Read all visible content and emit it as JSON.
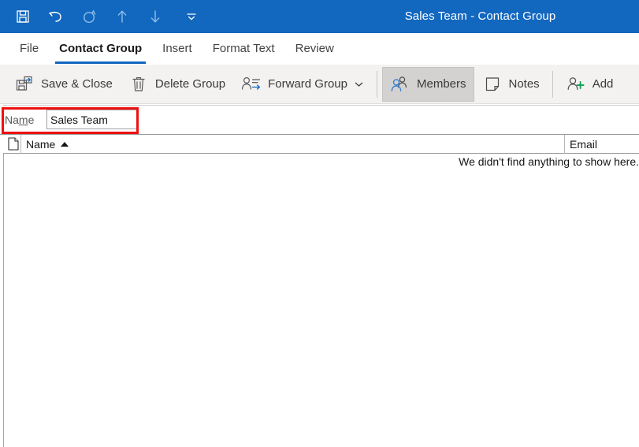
{
  "window": {
    "title": "Sales Team  -  Contact Group",
    "accent_color": "#1267bf",
    "ribbon_bg": "#f3f2f1"
  },
  "quick_access": {
    "items": [
      {
        "name": "save-icon",
        "label": "Save",
        "enabled": true
      },
      {
        "name": "undo-icon",
        "label": "Undo",
        "enabled": true
      },
      {
        "name": "redo-icon",
        "label": "Redo",
        "enabled": false
      },
      {
        "name": "previous-item-icon",
        "label": "Previous Item",
        "enabled": false
      },
      {
        "name": "next-item-icon",
        "label": "Next Item",
        "enabled": false
      }
    ],
    "customize_label": "Customize Quick Access Toolbar"
  },
  "tabs": [
    {
      "label": "File",
      "active": false
    },
    {
      "label": "Contact Group",
      "active": true
    },
    {
      "label": "Insert",
      "active": false
    },
    {
      "label": "Format Text",
      "active": false
    },
    {
      "label": "Review",
      "active": false
    }
  ],
  "ribbon": {
    "buttons": [
      {
        "label": "Save & Close",
        "icon": "save-close-icon",
        "selected": false,
        "dropdown": false
      },
      {
        "label": "Delete Group",
        "icon": "trash-icon",
        "selected": false,
        "dropdown": false
      },
      {
        "label": "Forward Group",
        "icon": "forward-group-icon",
        "selected": false,
        "dropdown": true
      },
      {
        "label": "Members",
        "icon": "members-icon",
        "selected": true,
        "dropdown": false
      },
      {
        "label": "Notes",
        "icon": "notes-icon",
        "selected": false,
        "dropdown": false
      },
      {
        "label": "Add",
        "icon": "add-member-icon",
        "selected": false,
        "dropdown": false
      }
    ]
  },
  "form": {
    "name_label_prefix": "Na",
    "name_label_accel": "m",
    "name_label_suffix": "e",
    "name_value": "Sales Team",
    "name_placeholder": ""
  },
  "annotation": {
    "color": "#ee1111",
    "target": "name-field-row"
  },
  "list": {
    "columns": [
      {
        "key": "icon",
        "label": "",
        "icon": "page-icon"
      },
      {
        "key": "name",
        "label": "Name",
        "sort": "ascending"
      },
      {
        "key": "email",
        "label": "Email",
        "sort": "none"
      }
    ],
    "rows": [],
    "empty_message": "We didn't find anything to show here."
  }
}
